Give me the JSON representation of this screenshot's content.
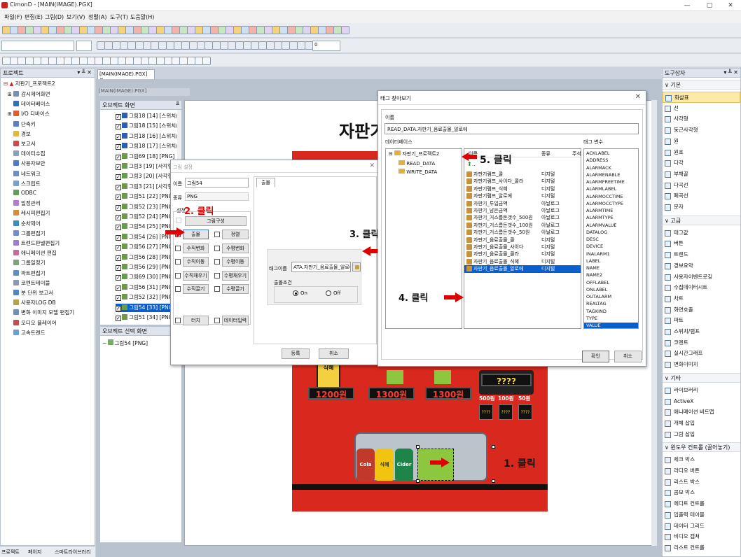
{
  "window": {
    "title": "CimonD - [MAIN(IMAGE).PGX]"
  },
  "menu": [
    "파일(F)",
    "편집(E)",
    "그림(D)",
    "보기(V)",
    "정렬(A)",
    "도구(T)",
    "도움말(H)"
  ],
  "format_toolbar": {
    "spin_value": "0"
  },
  "project_panel": {
    "title": "프로젝트",
    "root": "자판기_프로젝트2",
    "items": [
      "감시제어화면",
      "데이터베이스",
      "I/O 디바이스",
      "단축키",
      "경보",
      "보고서",
      "데이터수집",
      "사용자보안",
      "네트워크",
      "스크립트",
      "ODBC",
      "일정관리",
      "레시피편집기",
      "순차제어",
      "그룹편집기",
      "트렌드판넬편집기",
      "애니메이션 편집",
      "그룹일정기",
      "파트편집기",
      "코멘트테이블",
      "분 단위 보고서",
      "사용자LOG DB",
      "변화 이미지 모델 편집기",
      "오디오 플레이어",
      "고속트렌드"
    ],
    "bottom_tabs": [
      "프로젝트",
      "페이지",
      "스마트라이브러리"
    ]
  },
  "doc_tab": {
    "label": "[MAIN(IMAGE).PGX]",
    "inner_label": "[MAIN(IMAGE).PGX]"
  },
  "object_panel": {
    "title": "오브젝트 화면",
    "items": [
      "그림18 [14] [스위치/...",
      "그림18 [15] [스위치/...",
      "그림18 [16] [스위치/...",
      "그림18 [17] [스위치/...",
      "그림69 [18] [PNG]",
      "그림3 [19] [사각형]",
      "그림3 [20] [사각형]",
      "그림3 [21] [사각형]",
      "그림51 [22] [PNG]",
      "그림52 [23] [PNG]",
      "그림52 [24] [PNG]",
      "그림54 [25] [PNG]",
      "그림54 [26] [PNG]",
      "그림56 [27] [PNG]",
      "그림56 [28] [PNG]",
      "그림56 [29] [PNG]",
      "그림69 [30] [PNG]",
      "그림56 [31] [PNG]",
      "그림52 [32] [PNG]",
      "그림54 [33] [PNG]",
      "그림51 [34] [PNG]"
    ],
    "selected_index": 19
  },
  "selected_panel": {
    "title": "오브젝트 선택 화면",
    "item": "그림54 [PNG]"
  },
  "canvas": {
    "title": "자판기",
    "product": "식혜",
    "prices": [
      "1200원",
      "1300원",
      "1300원"
    ],
    "display": "????",
    "coins": [
      "500원",
      "100원",
      "50원"
    ],
    "coin_slots": [
      "????",
      "????",
      "????"
    ],
    "bottles": [
      "Cola",
      "식혜",
      "Cider"
    ]
  },
  "shape_dialog": {
    "title": "그림 설정",
    "name_label": "이름",
    "name_value": "그림54",
    "type_label": "종류",
    "type_value": "PNG",
    "settings_label": "설정",
    "group_btn": "그림구성",
    "buttons": [
      "출몰",
      "정렬",
      "수직변화",
      "수평변화",
      "수직이동",
      "수평이동",
      "수직채우기",
      "수평채우기",
      "수직끌기",
      "수평끌기",
      "터치",
      "데이터입력"
    ],
    "tab": "출몰",
    "tag_label": "태그이름",
    "tag_value": "ATA.자판기_음료출몰_알로에",
    "cond_label": "출몰조건",
    "cond_on": "On",
    "cond_off": "Off",
    "ok": "등록",
    "cancel": "취소"
  },
  "tag_dialog": {
    "title": "태그 찾아보기",
    "name_label": "이름",
    "name_value": "READ_DATA.자판기_음료출몰_알로에",
    "db_label": "데이터베이스",
    "tree_root": "자판기_프로젝트2",
    "tree_children": [
      "READ_DATA",
      "WRITE_DATA"
    ],
    "col_name": "이름",
    "col_type": "종류",
    "col_comment": "주석",
    "col_var": "태그 변수",
    "up_item": "..",
    "rows": [
      {
        "name": "자판기램프_콜",
        "type": "디지털"
      },
      {
        "name": "자판기램프_사이다_콜라",
        "type": "디지털"
      },
      {
        "name": "자판기램프_식혜",
        "type": "디지털"
      },
      {
        "name": "자판기램프_알로에",
        "type": "디지털"
      },
      {
        "name": "자판기_투입금액",
        "type": "아날로그"
      },
      {
        "name": "자판기_남은금액",
        "type": "아날로그"
      },
      {
        "name": "자판기_거스름돈갯수_500원",
        "type": "아날로그"
      },
      {
        "name": "자판기_거스름돈갯수_100원",
        "type": "아날로그"
      },
      {
        "name": "자판기_거스름돈갯수_50원",
        "type": "아날로그"
      },
      {
        "name": "자판기_음료출몰_콜",
        "type": "디지털"
      },
      {
        "name": "자판기_음료출몰_사이다",
        "type": "디지털"
      },
      {
        "name": "자판기_음료출몰_콜라",
        "type": "디지털"
      },
      {
        "name": "자판기_음료출몰_식혜",
        "type": "디지털"
      },
      {
        "name": "자판기_음료출몰_알로에",
        "type": "디지털"
      }
    ],
    "selected_row": 13,
    "vars": [
      "ACKLABEL",
      "ADDRESS",
      "ALARMACK",
      "ALARMENABLE",
      "ALARMFREETIME",
      "ALARMLABEL",
      "ALARMOCCTIME",
      "ALARMOCCTYPE",
      "ALARMTIME",
      "ALARMTYPE",
      "ALARMVALUE",
      "DATALOG",
      "DESC",
      "DEVICE",
      "INALARM1",
      "LABEL",
      "NAME",
      "NAME2",
      "OFFLABEL",
      "ONLABEL",
      "OUTALARM",
      "REALTAG",
      "TAGKIND",
      "TYPE",
      "VALUE"
    ],
    "selected_var": 24,
    "ok": "확인",
    "cancel": "취소"
  },
  "annotations": {
    "a1": "1. 클릭",
    "a2": "2. 클릭",
    "a3": "3. 클릭",
    "a4": "4. 클릭",
    "a5": "5. 클릭"
  },
  "toolbox": {
    "title": "도구상자",
    "sections": [
      {
        "name": "기본",
        "items": [
          "화살표",
          "선",
          "사각형",
          "둥근사각형",
          "원",
          "원호",
          "다각",
          "부채꼴",
          "다곡선",
          "폐곡선",
          "문자"
        ]
      },
      {
        "name": "고급",
        "items": [
          "태그값",
          "버튼",
          "트렌드",
          "경보요약",
          "사용자이벤트로깅",
          "수집데이터시트",
          "차트",
          "화면호출",
          "파트",
          "스위치/램프",
          "코멘트",
          "실시간그래프",
          "변화이미지"
        ]
      },
      {
        "name": "기타",
        "items": [
          "라이브러리",
          "ActiveX",
          "애니메이션 비트맵",
          "개체 삽입",
          "그림 삽입"
        ]
      },
      {
        "name": "윈도우 컨트롤 (끌어놓기)",
        "items": [
          "체크 박스",
          "라디오 버튼",
          "리스트 박스",
          "콤보 박스",
          "에디트 컨트롤",
          "입출력 테이블",
          "데이터 그리드",
          "비디오 캡쳐",
          "리스트 컨트롤"
        ]
      }
    ]
  },
  "colors": {
    "accent": "#0a5fcf",
    "red": "#e00000",
    "machine": "#d9281d"
  }
}
